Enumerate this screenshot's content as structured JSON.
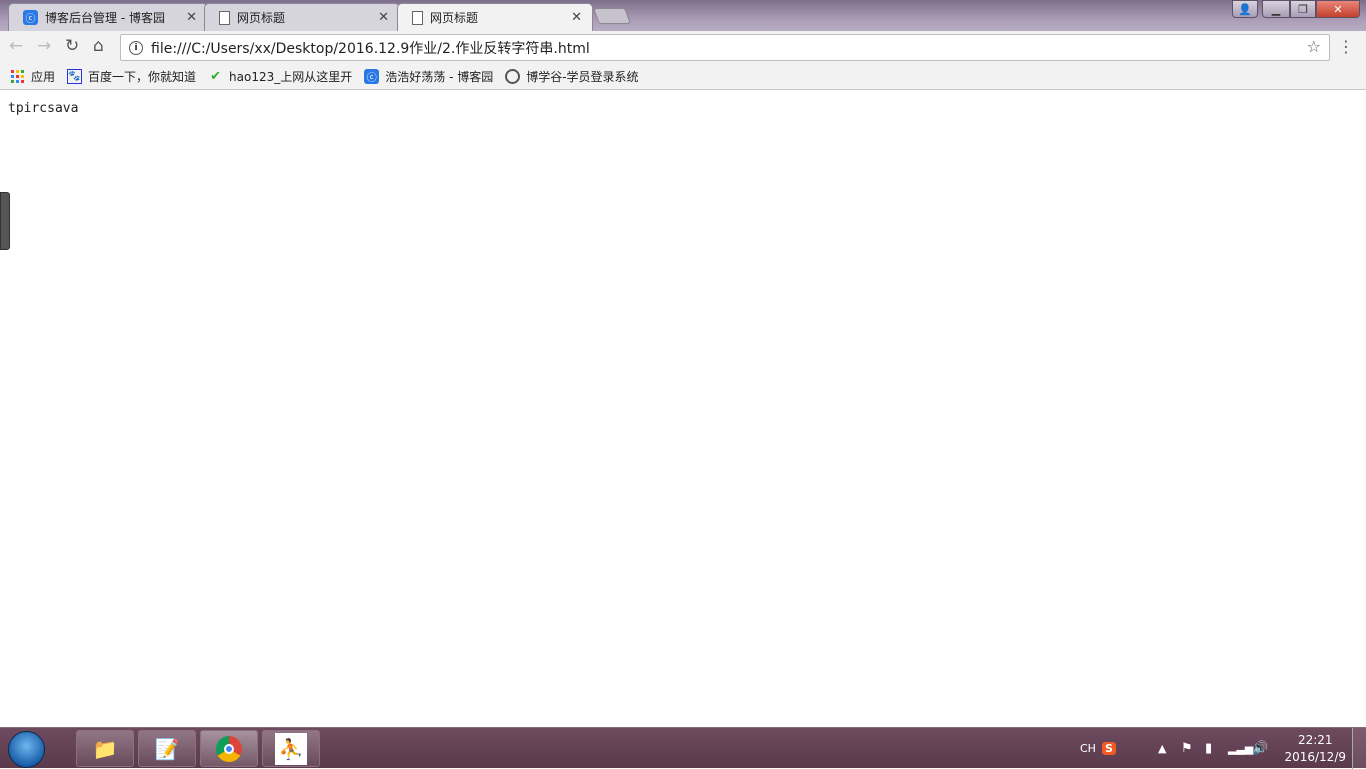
{
  "browser": {
    "tabs": [
      {
        "title": "博客后台管理 - 博客园",
        "icon": "cnblogs-icon",
        "active": false
      },
      {
        "title": "网页标题",
        "icon": "page-icon",
        "active": false
      },
      {
        "title": "网页标题",
        "icon": "page-icon",
        "active": true
      }
    ],
    "url": "file:///C:/Users/xx/Desktop/2016.12.9作业/2.作业反转字符串.html",
    "bookmarks": [
      {
        "label": "应用",
        "icon": "apps-icon"
      },
      {
        "label": "百度一下，你就知道",
        "icon": "baidu-icon"
      },
      {
        "label": "hao123_上网从这里开",
        "icon": "hao123-icon"
      },
      {
        "label": "浩浩好荡荡 - 博客园",
        "icon": "cnblogs-icon"
      },
      {
        "label": "博学谷-学员登录系统",
        "icon": "boxuegu-icon"
      }
    ]
  },
  "page": {
    "output": "tpircsava"
  },
  "taskbar": {
    "apps": [
      "explorer-icon",
      "notepad-icon",
      "chrome-icon",
      "jordan-icon"
    ],
    "ime": "CH",
    "time": "22:21",
    "date": "2016/12/9"
  }
}
